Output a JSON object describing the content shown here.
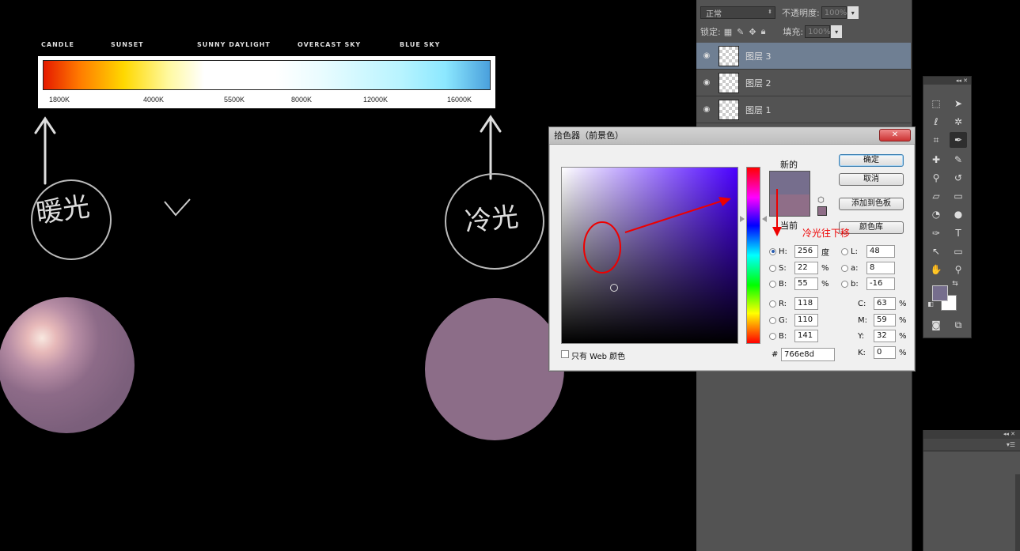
{
  "kelvin_chart": {
    "top_labels": [
      "CANDLE",
      "SUNSET",
      "SUNNY DAYLIGHT",
      "OVERCAST SKY",
      "BLUE SKY"
    ],
    "ticks": [
      "1800K",
      "4000K",
      "5500K",
      "8000K",
      "12000K",
      "16000K"
    ]
  },
  "annotations": {
    "warm": "暖光",
    "cool": "冷光",
    "cool_hint": "冷光往下移"
  },
  "layers_panel": {
    "blend_mode": "正常",
    "opacity_label": "不透明度:",
    "opacity_value": "100%",
    "lock_label": "锁定:",
    "fill_label": "填充:",
    "fill_value": "100%",
    "layers": [
      {
        "name": "图层 3",
        "selected": true
      },
      {
        "name": "图层 2",
        "selected": false
      },
      {
        "name": "图层 1",
        "selected": false
      }
    ]
  },
  "color_picker": {
    "title": "拾色器（前景色）",
    "new_label": "新的",
    "current_label": "当前",
    "buttons": {
      "ok": "确定",
      "cancel": "取消",
      "add_swatch": "添加到色板",
      "libraries": "颜色库"
    },
    "hsb": {
      "H": "256",
      "S": "22",
      "B": "55",
      "h_unit": "度",
      "s_unit": "%",
      "b_unit": "%"
    },
    "lab": {
      "L": "48",
      "a": "8",
      "b": "-16"
    },
    "rgb": {
      "R": "118",
      "G": "110",
      "B": "141"
    },
    "cmyk": {
      "C": "63",
      "M": "59",
      "Y": "32",
      "K": "0",
      "unit": "%"
    },
    "hex_label": "#",
    "hex": "766e8d",
    "web_only_label": "只有 Web 颜色",
    "new_color": "#766e8d",
    "current_color": "#8f6e88"
  },
  "colors": {
    "foreground": "#766e8d",
    "background": "#ffffff",
    "sphere": "#8c6d88",
    "annotation_red": "#ee0000"
  }
}
